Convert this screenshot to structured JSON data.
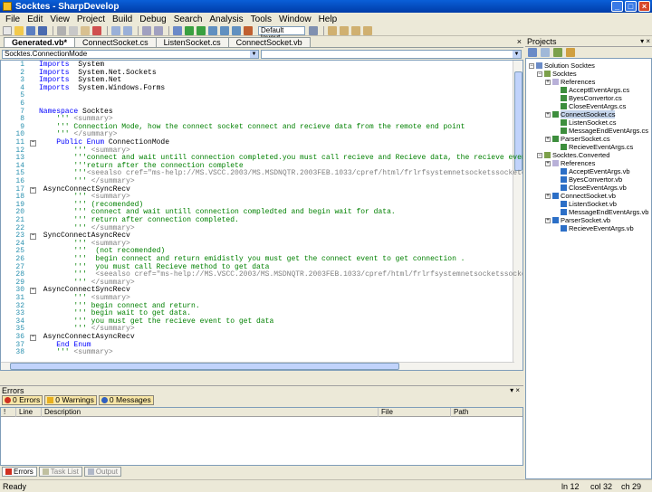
{
  "window": {
    "title": "Socktes - SharpDevelop"
  },
  "menu": [
    "File",
    "Edit",
    "View",
    "Project",
    "Build",
    "Debug",
    "Search",
    "Analysis",
    "Tools",
    "Window",
    "Help"
  ],
  "toolbar": {
    "layout_combo": "Default layout"
  },
  "doc_tabs": [
    "Generated.vb*",
    "ConnectSocket.cs",
    "ListenSocket.cs",
    "ConnectSocket.vb"
  ],
  "editor": {
    "class_combo": "Socktes.ConnectionMode",
    "member_combo": "",
    "lines": [
      {
        "n": "1",
        "t": [
          [
            "kw",
            "Imports"
          ],
          [
            "",
            "  System"
          ]
        ]
      },
      {
        "n": "2",
        "t": [
          [
            "kw",
            "Imports"
          ],
          [
            "",
            "  System.Net.Sockets"
          ]
        ]
      },
      {
        "n": "3",
        "t": [
          [
            "kw",
            "Imports"
          ],
          [
            "",
            "  System.Net"
          ]
        ]
      },
      {
        "n": "4",
        "t": [
          [
            "kw",
            "Imports"
          ],
          [
            "",
            "  System.Windows.Forms"
          ]
        ]
      },
      {
        "n": "5",
        "t": []
      },
      {
        "n": "6",
        "t": []
      },
      {
        "n": "7",
        "t": [
          [
            "kw",
            "Namespace"
          ],
          [
            "",
            " Socktes"
          ]
        ]
      },
      {
        "n": "8",
        "t": [
          [
            "cm",
            "    '''"
          ],
          [
            "xml",
            " <summary>"
          ]
        ]
      },
      {
        "n": "9",
        "t": [
          [
            "cm",
            "    ''' Connection Mode, how the connect socket connect and recieve data from the remote end point"
          ]
        ]
      },
      {
        "n": "10",
        "t": [
          [
            "cm",
            "    '''"
          ],
          [
            "xml",
            " </summary>"
          ]
        ]
      },
      {
        "n": "11",
        "t": [
          [
            "kw",
            "    Public Enum"
          ],
          [
            "",
            " ConnectionMode"
          ]
        ]
      },
      {
        "n": "12",
        "t": [
          [
            "cm",
            "        '''"
          ],
          [
            "xml",
            " <summary>"
          ]
        ]
      },
      {
        "n": "13",
        "t": [
          [
            "cm",
            "        '''connect and wait untill connection completed.you must call recieve and Recieve data, the recieve event wi"
          ]
        ]
      },
      {
        "n": "14",
        "t": [
          [
            "cm",
            "        '''return after the connection complete"
          ]
        ]
      },
      {
        "n": "15",
        "t": [
          [
            "cm",
            "        '''"
          ],
          [
            "xml",
            "<seealso cref=\"ms-help://MS.VSCC.2003/MS.MSDNQTR.2003FEB.1033/cpref/html/frlrfsystemnetsocketssocketclass"
          ]
        ]
      },
      {
        "n": "16",
        "t": [
          [
            "cm",
            "        '''"
          ],
          [
            "xml",
            " </summary>"
          ]
        ]
      },
      {
        "n": "17",
        "t": [
          [
            "",
            " AsyncConnectSyncRecv"
          ]
        ]
      },
      {
        "n": "18",
        "t": [
          [
            "cm",
            "        '''"
          ],
          [
            "xml",
            " <summary>"
          ]
        ]
      },
      {
        "n": "19",
        "t": [
          [
            "cm",
            "        ''' (recomended)"
          ]
        ]
      },
      {
        "n": "20",
        "t": [
          [
            "cm",
            "        ''' connect and wait untill connection compledted and begin wait for data."
          ]
        ]
      },
      {
        "n": "21",
        "t": [
          [
            "cm",
            "        ''' return after connection completed."
          ]
        ]
      },
      {
        "n": "22",
        "t": [
          [
            "cm",
            "        '''"
          ],
          [
            "xml",
            " </summary>"
          ]
        ]
      },
      {
        "n": "23",
        "t": [
          [
            "",
            " SyncConnectAsyncRecv"
          ]
        ]
      },
      {
        "n": "24",
        "t": [
          [
            "cm",
            "        '''"
          ],
          [
            "xml",
            " <summary>"
          ]
        ]
      },
      {
        "n": "25",
        "t": [
          [
            "cm",
            "        '''  (not recomended)"
          ]
        ]
      },
      {
        "n": "26",
        "t": [
          [
            "cm",
            "        '''  begin connect and return emidistly you must get the connect event to get connection ."
          ]
        ]
      },
      {
        "n": "27",
        "t": [
          [
            "cm",
            "        '''  you must call Recieve method to get data"
          ]
        ]
      },
      {
        "n": "28",
        "t": [
          [
            "cm",
            "        '''  "
          ],
          [
            "xml",
            "<seealso cref=\"ms-help://MS.VSCC.2003/MS.MSDNQTR.2003FEB.1033/cpref/html/frlrfsystemnetsocketssocketcla"
          ]
        ]
      },
      {
        "n": "29",
        "t": [
          [
            "cm",
            "        '''"
          ],
          [
            "xml",
            " </summary>"
          ]
        ]
      },
      {
        "n": "30",
        "t": [
          [
            "",
            " AsyncConnectSyncRecv"
          ]
        ]
      },
      {
        "n": "31",
        "t": [
          [
            "cm",
            "        '''"
          ],
          [
            "xml",
            " <summary>"
          ]
        ]
      },
      {
        "n": "32",
        "t": [
          [
            "cm",
            "        ''' begin connect and return."
          ]
        ]
      },
      {
        "n": "33",
        "t": [
          [
            "cm",
            "        ''' begin wait to get data."
          ]
        ]
      },
      {
        "n": "34",
        "t": [
          [
            "cm",
            "        ''' you must get the recieve event to get data"
          ]
        ]
      },
      {
        "n": "35",
        "t": [
          [
            "cm",
            "        '''"
          ],
          [
            "xml",
            " </summary>"
          ]
        ]
      },
      {
        "n": "36",
        "t": [
          [
            "",
            " AsyncConnectAsyncRecv"
          ]
        ]
      },
      {
        "n": "37",
        "t": [
          [
            "kw",
            "    End Enum"
          ]
        ]
      },
      {
        "n": "38",
        "t": [
          [
            "cm",
            "    '''"
          ],
          [
            "xml",
            " <summary>"
          ]
        ]
      }
    ]
  },
  "projects": {
    "title": "Projects",
    "tree": [
      {
        "label": "Solution Socktes",
        "indent": 0,
        "icon": "sol",
        "ex": "-"
      },
      {
        "label": "Socktes",
        "indent": 1,
        "icon": "proj",
        "ex": "-"
      },
      {
        "label": "References",
        "indent": 2,
        "icon": "ref",
        "ex": "+"
      },
      {
        "label": "AcceptEventArgs.cs",
        "indent": 3,
        "icon": "cs",
        "ex": ""
      },
      {
        "label": "ByesConvertor.cs",
        "indent": 3,
        "icon": "cs",
        "ex": ""
      },
      {
        "label": "CloseEventArgs.cs",
        "indent": 3,
        "icon": "cs",
        "ex": ""
      },
      {
        "label": "ConnectSocket.cs",
        "indent": 2,
        "icon": "cs",
        "ex": "+",
        "sel": true
      },
      {
        "label": "ListenSocket.cs",
        "indent": 3,
        "icon": "cs",
        "ex": ""
      },
      {
        "label": "MessageEndEventArgs.cs",
        "indent": 3,
        "icon": "cs",
        "ex": ""
      },
      {
        "label": "ParserSocket.cs",
        "indent": 2,
        "icon": "cs",
        "ex": "+"
      },
      {
        "label": "RecieveEventArgs.cs",
        "indent": 3,
        "icon": "cs",
        "ex": ""
      },
      {
        "label": "Socktes.Converted",
        "indent": 1,
        "icon": "proj",
        "ex": "-"
      },
      {
        "label": "References",
        "indent": 2,
        "icon": "ref",
        "ex": "+"
      },
      {
        "label": "AcceptEventArgs.vb",
        "indent": 3,
        "icon": "vb",
        "ex": ""
      },
      {
        "label": "ByesConvertor.vb",
        "indent": 3,
        "icon": "vb",
        "ex": ""
      },
      {
        "label": "CloseEventArgs.vb",
        "indent": 3,
        "icon": "vb",
        "ex": ""
      },
      {
        "label": "ConnectSocket.vb",
        "indent": 2,
        "icon": "vb",
        "ex": "+"
      },
      {
        "label": "ListenSocket.vb",
        "indent": 3,
        "icon": "vb",
        "ex": ""
      },
      {
        "label": "MessageEndEventArgs.vb",
        "indent": 3,
        "icon": "vb",
        "ex": ""
      },
      {
        "label": "ParserSocket.vb",
        "indent": 2,
        "icon": "vb",
        "ex": "+"
      },
      {
        "label": "RecieveEventArgs.vb",
        "indent": 3,
        "icon": "vb",
        "ex": ""
      }
    ]
  },
  "errors": {
    "title": "Errors",
    "errors_btn": "0 Errors",
    "warnings_btn": "0 Warnings",
    "messages_btn": "0 Messages",
    "columns": [
      "!",
      "Line",
      "Description",
      "File",
      "Path"
    ],
    "tabs": [
      "Errors",
      "Task List",
      "Output"
    ]
  },
  "status": {
    "ready": "Ready",
    "line": "ln 12",
    "col": "col 32",
    "ch": "ch 29"
  },
  "colors": {
    "title_bar": "#0a5fd8",
    "keyword": "#0000ff",
    "comment": "#008000",
    "xml_doc": "#808080"
  }
}
